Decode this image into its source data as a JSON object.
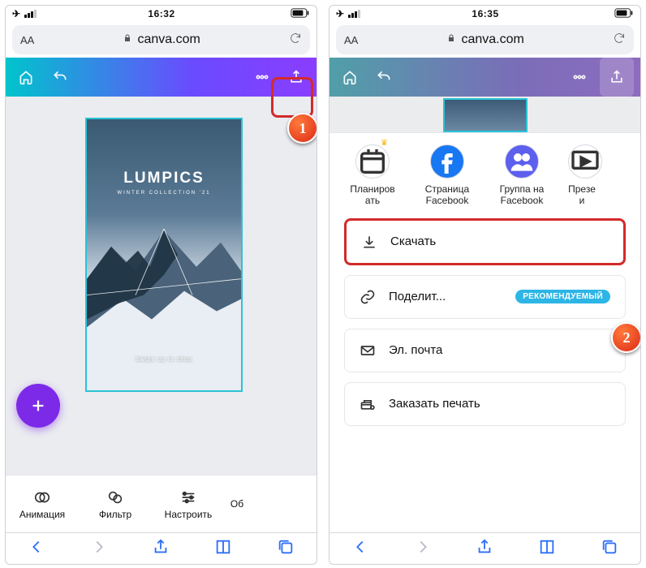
{
  "markers": {
    "one": "1",
    "two": "2"
  },
  "left": {
    "status": {
      "time": "16:32"
    },
    "url": {
      "aa": "AA",
      "domain": "canva.com"
    },
    "design": {
      "title": "LUMPICS",
      "subtitle": "WINTER COLLECTION '21",
      "swipe": "Swipe up to shop"
    },
    "bottom": [
      "Анимация",
      "Фильтр",
      "Настроить",
      "Об"
    ]
  },
  "right": {
    "status": {
      "time": "16:35"
    },
    "url": {
      "aa": "AA",
      "domain": "canva.com"
    },
    "share": [
      {
        "label": "Планиров\nать"
      },
      {
        "label": "Страница\nFacebook"
      },
      {
        "label": "Группа на\nFacebook"
      },
      {
        "label": "Презе\nи"
      }
    ],
    "items": {
      "download": "Скачать",
      "share": "Поделит...",
      "share_badge": "РЕКОМЕНДУЕМЫЙ",
      "email": "Эл. почта",
      "print": "Заказать печать"
    }
  }
}
